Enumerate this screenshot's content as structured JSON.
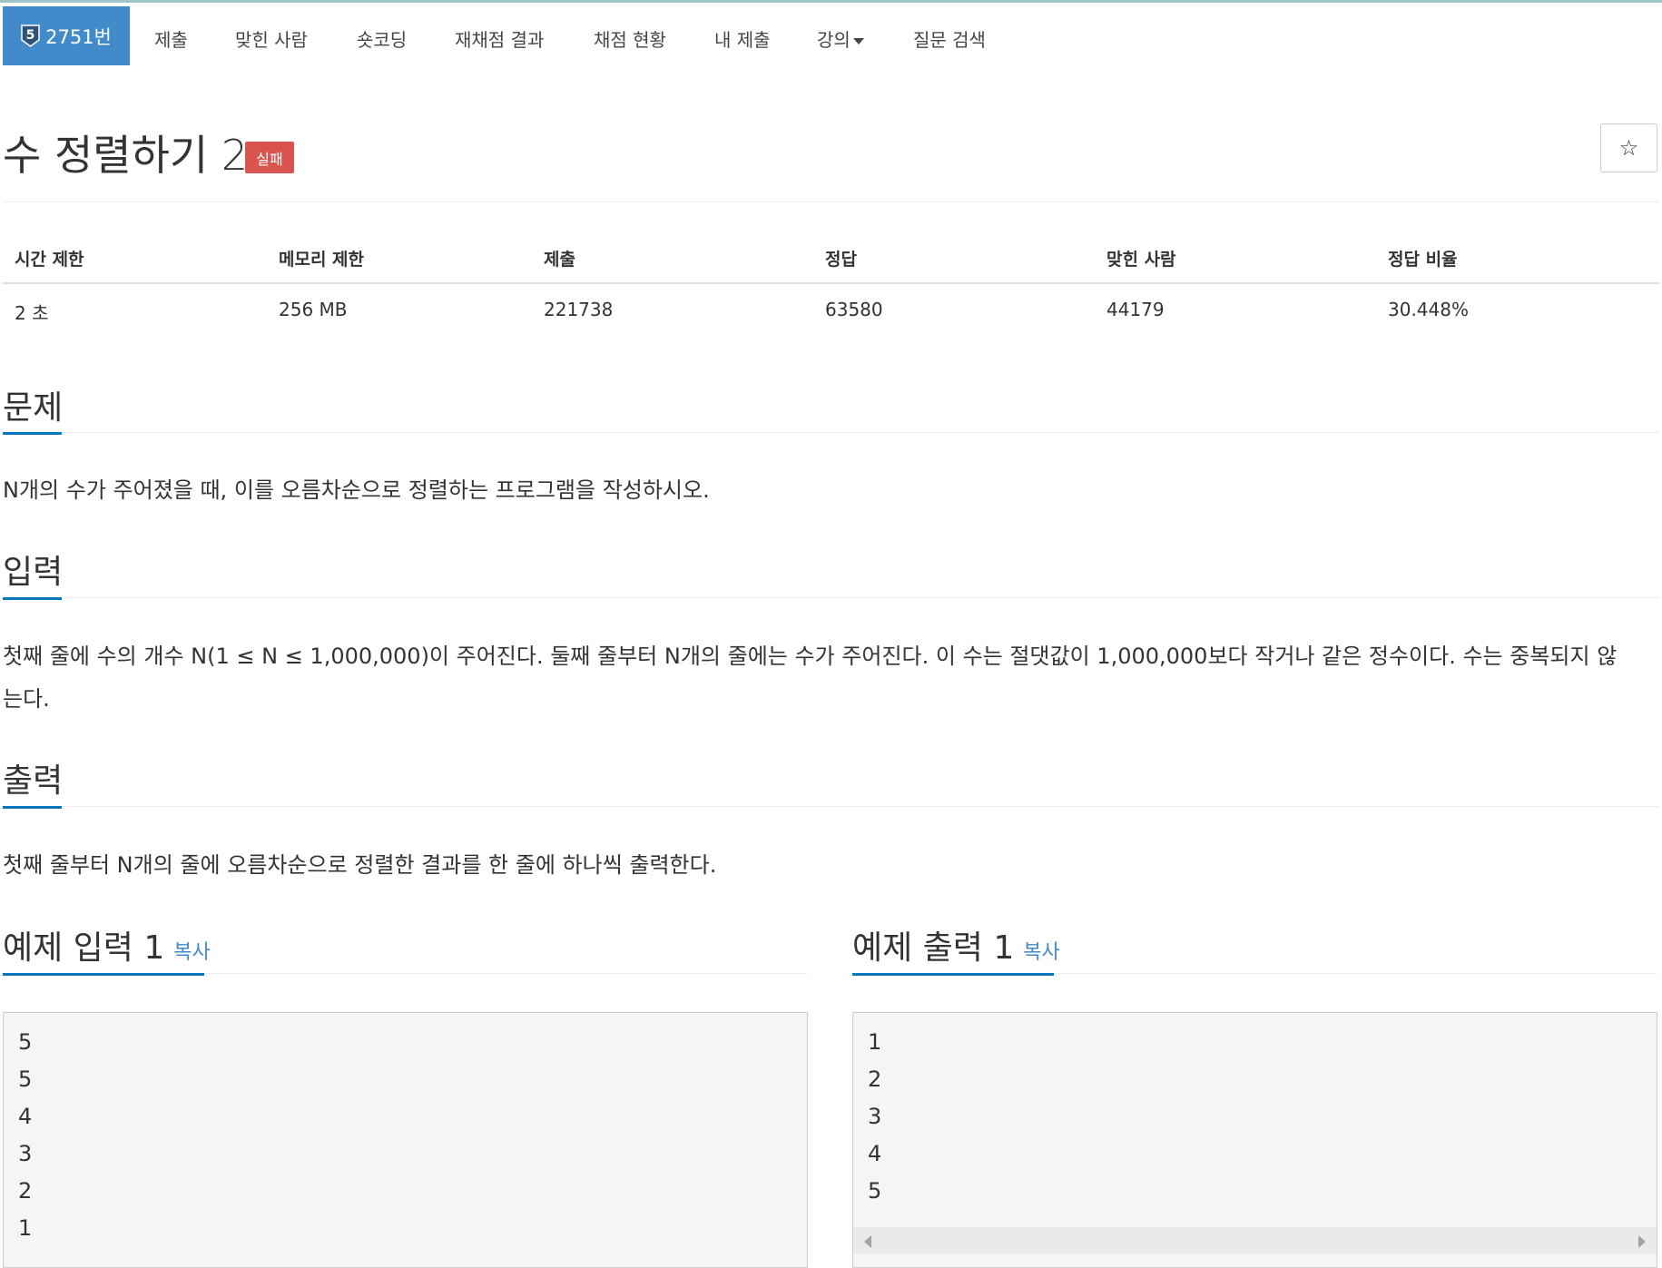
{
  "nav": {
    "problem_tab": "2751번",
    "tier_level": "5",
    "items": [
      "제출",
      "맞힌 사람",
      "숏코딩",
      "재채점 결과",
      "채점 현황",
      "내 제출",
      "강의",
      "질문 검색"
    ]
  },
  "problem": {
    "title": "수 정렬하기 2",
    "status_badge": "실패",
    "star_icon": "star-outline"
  },
  "stats": {
    "headers": [
      "시간 제한",
      "메모리 제한",
      "제출",
      "정답",
      "맞힌 사람",
      "정답 비율"
    ],
    "values": [
      "2 초",
      "256 MB",
      "221738",
      "63580",
      "44179",
      "30.448%"
    ]
  },
  "sections": {
    "problem_heading": "문제",
    "problem_text": "N개의 수가 주어졌을 때, 이를 오름차순으로 정렬하는 프로그램을 작성하시오.",
    "input_heading": "입력",
    "input_text_line1": "첫째 줄에 수의 개수 N(1 ≤ N ≤ 1,000,000)이 주어진다. 둘째 줄부터 N개의 줄에는 수가 주어진다. 이 수는 절댓값이 1,000,000보다 작거나 같은 정수이다. 수는 중복되지 않",
    "input_text_line2": "는다.",
    "output_heading": "출력",
    "output_text": "첫째 줄부터 N개의 줄에 오름차순으로 정렬한 결과를 한 줄에 하나씩 출력한다."
  },
  "samples": {
    "input_heading": "예제 입력 1",
    "output_heading": "예제 출력 1",
    "copy_label": "복사",
    "input_lines": [
      "5",
      "5",
      "4",
      "3",
      "2",
      "1"
    ],
    "output_lines": [
      "1",
      "2",
      "3",
      "4",
      "5"
    ]
  },
  "colors": {
    "active_tab": "#428bca",
    "badge_fail": "#d9534f",
    "section_underline": "#0076c0",
    "link": "#428bca"
  }
}
